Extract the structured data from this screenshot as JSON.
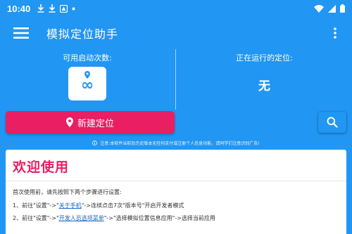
{
  "status_bar": {
    "time": "10:40"
  },
  "app_bar": {
    "title": "模拟定位助手",
    "menu_icon": "hamburger-menu-icon",
    "more_icon": "more-vert-icon"
  },
  "stats": {
    "available_label": "可用启动次数:",
    "available_value": "∞",
    "running_label": "正在运行的定位:",
    "running_value": "无"
  },
  "actions": {
    "new_location_label": "新建定位",
    "search_icon": "search-icon"
  },
  "notice": {
    "text": "注意:本软件当前及历史版本无任何支付或注册个人信息功能，请同学们注意识别广告!"
  },
  "welcome": {
    "title": "欢迎使用",
    "intro": "首次使用前，请先按照下两个步骤进行设置:",
    "step1": {
      "prefix": "1、前往\"设置\"->\"",
      "link": "关于手机",
      "suffix": "\"->连续点击7次\"版本号\"开启开发者模式"
    },
    "step2": {
      "prefix": "2、前往\"设置\"->\"",
      "link": "开发人员选项菜单",
      "suffix": "\"->\"选择模拟位置信息应用\"->选择当前应用"
    }
  },
  "colors": {
    "primary": "#2196f3",
    "accent": "#e91e63"
  }
}
